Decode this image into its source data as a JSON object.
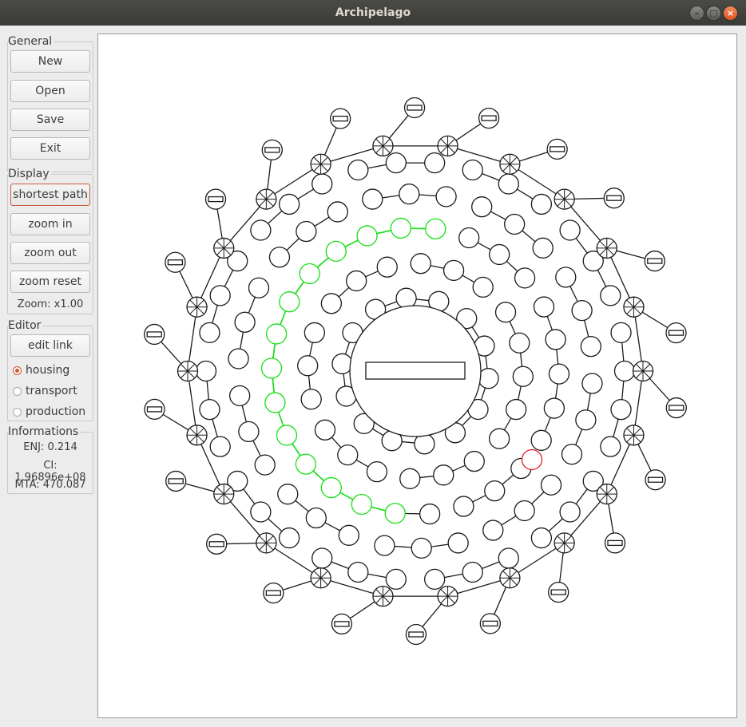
{
  "window": {
    "title": "Archipelago"
  },
  "controls": {
    "minimize": "–",
    "maximize": "□",
    "close": "×"
  },
  "general": {
    "label": "General",
    "new": "New",
    "open": "Open",
    "save": "Save",
    "exit": "Exit"
  },
  "display": {
    "label": "Display",
    "shortest_path": "shortest path",
    "zoom_in": "zoom in",
    "zoom_out": "zoom out",
    "zoom_reset": "zoom reset",
    "zoom": "Zoom: x1.00"
  },
  "editor": {
    "label": "Editor",
    "edit_link": "edit link",
    "options": [
      "housing",
      "transport",
      "production"
    ],
    "selected": "housing"
  },
  "informations": {
    "label": "Informations",
    "enj": "ENJ: 0.214",
    "ci": "CI: 1.96896e+08",
    "mta": "MTA: 470.087"
  },
  "colors": {
    "path": "#16e016",
    "selected_node": "#e02020",
    "node_stroke": "#1a1a1a",
    "accent": "#d2562c"
  }
}
